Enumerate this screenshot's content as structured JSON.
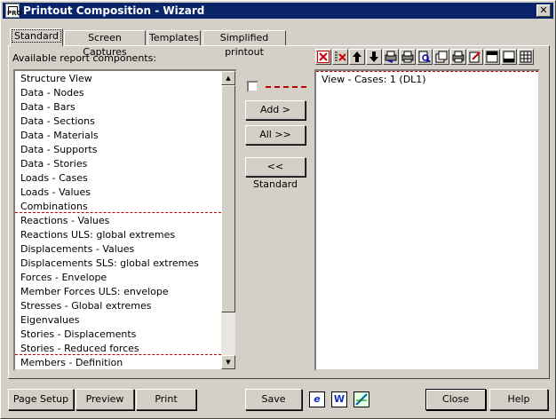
{
  "window": {
    "title": "Printout Composition - Wizard",
    "icon_text": "PRO"
  },
  "tabs": [
    {
      "label": "Standard"
    },
    {
      "label": "Screen Captures"
    },
    {
      "label": "Templates"
    },
    {
      "label": "Simplified printout"
    }
  ],
  "left": {
    "heading": "Available report components:",
    "items": [
      "Structure View",
      "Data - Nodes",
      "Data - Bars",
      "Data - Sections",
      "Data - Materials",
      "Data - Supports",
      "Data - Stories",
      "Loads - Cases",
      "Loads - Values",
      "Combinations",
      "Reactions - Values",
      "Reactions ULS: global extremes",
      "Displacements - Values",
      "Displacements SLS: global extremes",
      "Forces - Envelope",
      "Member Forces ULS: envelope",
      "Stresses - Global extremes",
      "Eigenvalues",
      "Stories - Displacements",
      "Stories - Reduced forces",
      "Members - Definition"
    ]
  },
  "middle": {
    "add_label": "Add >",
    "all_label": "All >>",
    "standard_label": "<< Standard"
  },
  "right": {
    "items": [
      "View - Cases: 1 (DL1)"
    ]
  },
  "toolbar": {
    "icons": [
      "delete-icon",
      "delete-all-icon",
      "move-up-icon",
      "move-down-icon",
      "print-settings-icon",
      "print-icon",
      "preview-icon",
      "page-icon",
      "printer-icon",
      "edit-icon",
      "header-icon",
      "footer-icon",
      "table-icon"
    ]
  },
  "bottom": {
    "page_setup_label": "Page Setup",
    "preview_label": "Preview",
    "print_label": "Print",
    "save_label": "Save",
    "close_label": "Close",
    "help_label": "Help",
    "ie_icon_text": "e",
    "word_icon_text": "W"
  },
  "colors": {
    "title_bar": "#0a246a",
    "separator": "#c00000",
    "face": "#d4d0c8"
  }
}
